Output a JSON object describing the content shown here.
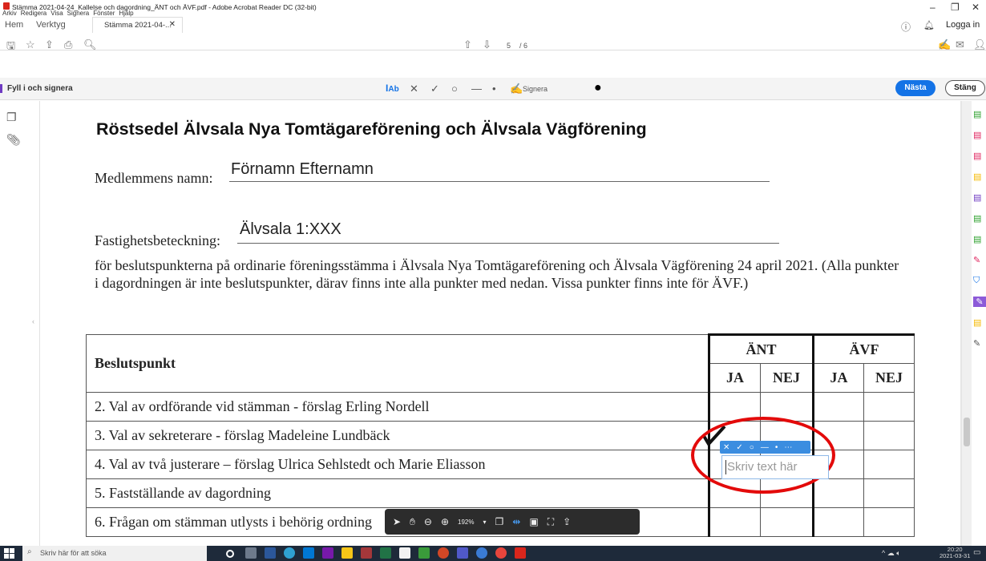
{
  "window": {
    "title": "Stämma 2021-04-24_Kallelse och dagordning_ÄNT och ÄVF.pdf - Adobe Acrobat Reader DC (32-bit)",
    "menu": [
      "Arkiv",
      "Redigera",
      "Visa",
      "Signera",
      "Fönster",
      "Hjälp"
    ]
  },
  "tabs": {
    "home": "Hem",
    "tools": "Verktyg",
    "doc_tab": "Stämma 2021-04-...",
    "login": "Logga in"
  },
  "toolbar": {
    "page_current": "5",
    "page_total": "/ 6"
  },
  "sign": {
    "label": "Fyll i och signera",
    "sign_label": "Signera",
    "next": "Nästa",
    "close": "Stäng"
  },
  "document": {
    "title": "Röstsedel Älvsala Nya Tomtägareförening och Älvsala Vägförening",
    "member_label": "Medlemmens namn:",
    "member_value": "Förnamn Efternamn",
    "property_label": "Fastighetsbeteckning:",
    "property_value": "Älvsala 1:XXX",
    "paragraph": "för beslutspunkterna på ordinarie föreningsstämma i Älvsala Nya Tomtägareförening och Älvsala Vägförening 24 april 2021. (Alla punkter i dagordningen är inte beslutspunkter, därav finns inte alla punkter med nedan. Vissa punkter finns inte för ÄVF.)",
    "table": {
      "header": "Beslutspunkt",
      "group1": "ÄNT",
      "group2": "ÄVF",
      "ja": "JA",
      "nej": "NEJ",
      "rows": [
        "2. Val av ordförande vid stämman - förslag Erling Nordell",
        "3. Val av sekreterare - förslag Madeleine Lundbäck",
        "4. Val av två justerare – förslag Ulrica Sehlstedt och Marie Eliasson",
        "5. Fastställande av dagordning",
        "6. Frågan om stämman utlysts i behörig ordning"
      ]
    }
  },
  "annotation": {
    "placeholder": "Skriv text här"
  },
  "floatbar": {
    "zoom": "192%"
  },
  "taskbar": {
    "search": "Skriv här för att söka",
    "time": "20:20",
    "date": "2021-03-31"
  }
}
